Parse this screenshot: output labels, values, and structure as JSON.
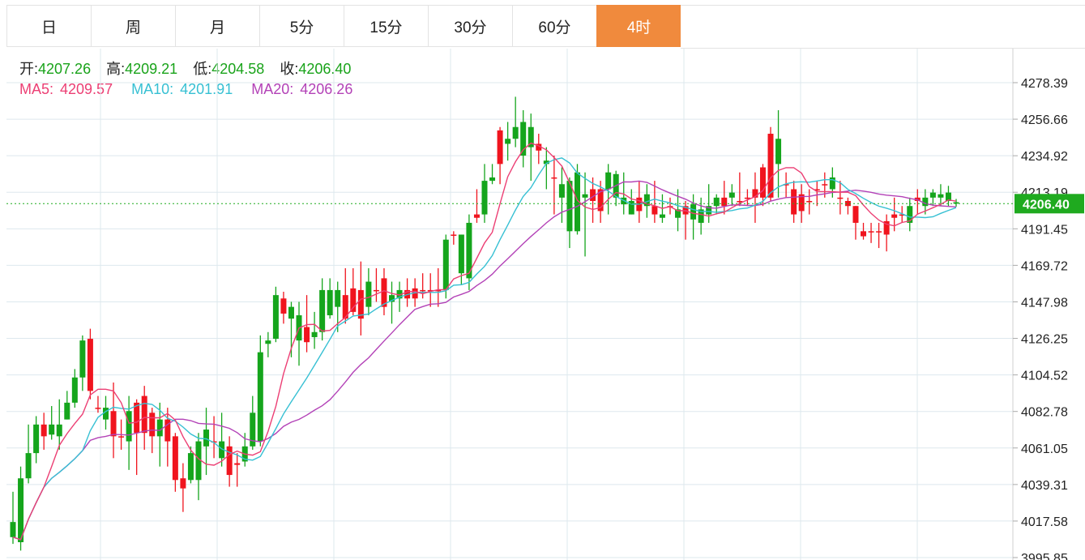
{
  "tabs": [
    {
      "label": "日",
      "active": false
    },
    {
      "label": "周",
      "active": false
    },
    {
      "label": "月",
      "active": false
    },
    {
      "label": "5分",
      "active": false
    },
    {
      "label": "15分",
      "active": false
    },
    {
      "label": "30分",
      "active": false
    },
    {
      "label": "60分",
      "active": false
    },
    {
      "label": "4时",
      "active": true
    }
  ],
  "ohlc": {
    "open_label": "开:",
    "open": "4207.26",
    "high_label": "高:",
    "high": "4209.21",
    "low_label": "低:",
    "low": "4204.58",
    "close_label": "收:",
    "close": "4206.40"
  },
  "ma": {
    "ma5_label": "MA5:",
    "ma5": "4209.57",
    "ma10_label": "MA10:",
    "ma10": "4201.91",
    "ma20_label": "MA20:",
    "ma20": "4206.26"
  },
  "colors": {
    "up": "#f0141e",
    "down": "#15a51c",
    "ma5": "#ec3f74",
    "ma10": "#37c0d3",
    "ma20": "#b342b7",
    "active_tab": "#f08a3d",
    "price_line": "#1faa1f",
    "grid": "#dde8ee"
  },
  "chart_data": {
    "type": "candlestick",
    "y_ticks": [
      "4278.39",
      "4256.66",
      "4234.92",
      "4213.19",
      "4191.45",
      "4169.72",
      "4147.98",
      "4126.25",
      "4104.52",
      "4082.78",
      "4061.05",
      "4039.31",
      "4017.58",
      "3995.85"
    ],
    "ylim": [
      3995.85,
      4289
    ],
    "last_price": "4206.40",
    "grid": true,
    "candles": [
      [
        4017,
        4008,
        4035,
        4004
      ],
      [
        4043,
        4005,
        4050,
        4000
      ],
      [
        4058,
        4043,
        4075,
        4040
      ],
      [
        4075,
        4058,
        4080,
        4052
      ],
      [
        4068,
        4075,
        4082,
        4060
      ],
      [
        4075,
        4069,
        4086,
        4066
      ],
      [
        4075,
        4068,
        4090,
        4060
      ],
      [
        4088,
        4078,
        4095,
        4078
      ],
      [
        4103,
        4088,
        4108,
        4085
      ],
      [
        4125,
        4103,
        4128,
        4095
      ],
      [
        4095,
        4126,
        4132,
        4090
      ],
      [
        4085,
        4085,
        4092,
        4082
      ],
      [
        4085,
        4078,
        4092,
        4072
      ],
      [
        4068,
        4083,
        4100,
        4055
      ],
      [
        4068,
        4068,
        4078,
        4060
      ],
      [
        4083,
        4065,
        4092,
        4048
      ],
      [
        4070,
        4088,
        4090,
        4045
      ],
      [
        4070,
        4092,
        4098,
        4060
      ],
      [
        4068,
        4082,
        4085,
        4058
      ],
      [
        4078,
        4068,
        4088,
        4050
      ],
      [
        4065,
        4078,
        4085,
        4050
      ],
      [
        4042,
        4068,
        4070,
        4035
      ],
      [
        4037,
        4043,
        4052,
        4023
      ],
      [
        4058,
        4042,
        4062,
        4040
      ],
      [
        4065,
        4042,
        4070,
        4030
      ],
      [
        4072,
        4062,
        4085,
        4045
      ],
      [
        4065,
        4065,
        4080,
        4055
      ],
      [
        4065,
        4055,
        4082,
        4050
      ],
      [
        4045,
        4062,
        4068,
        4038
      ],
      [
        4051,
        4052,
        4058,
        4038
      ],
      [
        4062,
        4053,
        4070,
        4050
      ],
      [
        4082,
        4062,
        4092,
        4060
      ],
      [
        4118,
        4065,
        4128,
        4062
      ],
      [
        4125,
        4123,
        4130,
        4115
      ],
      [
        4152,
        4126,
        4157,
        4124
      ],
      [
        4141,
        4150,
        4154,
        4135
      ],
      [
        4145,
        4138,
        4148,
        4115
      ],
      [
        4140,
        4125,
        4148,
        4110
      ],
      [
        4124,
        4133,
        4152,
        4118
      ],
      [
        4130,
        4127,
        4142,
        4120
      ],
      [
        4155,
        4130,
        4162,
        4125
      ],
      [
        4155,
        4140,
        4162,
        4138
      ],
      [
        4155,
        4145,
        4160,
        4130
      ],
      [
        4138,
        4152,
        4168,
        4135
      ],
      [
        4142,
        4156,
        4168,
        4140
      ],
      [
        4138,
        4155,
        4172,
        4128
      ],
      [
        4160,
        4145,
        4168,
        4140
      ],
      [
        4155,
        4155,
        4168,
        4148
      ],
      [
        4145,
        4162,
        4168,
        4140
      ],
      [
        4152,
        4148,
        4160,
        4135
      ],
      [
        4155,
        4150,
        4160,
        4142
      ],
      [
        4150,
        4155,
        4162,
        4145
      ],
      [
        4150,
        4156,
        4162,
        4145
      ],
      [
        4155,
        4155,
        4165,
        4150
      ],
      [
        4155,
        4155,
        4165,
        4145
      ],
      [
        4155,
        4155,
        4168,
        4145
      ],
      [
        4185,
        4155,
        4188,
        4150
      ],
      [
        4188,
        4188,
        4190,
        4182
      ],
      [
        4188,
        4165,
        4188,
        4158
      ],
      [
        4195,
        4162,
        4200,
        4155
      ],
      [
        4198,
        4200,
        4215,
        4195
      ],
      [
        4220,
        4200,
        4230,
        4195
      ],
      [
        4222,
        4220,
        4230,
        4218
      ],
      [
        4230,
        4250,
        4252,
        4218
      ],
      [
        4245,
        4242,
        4255,
        4232
      ],
      [
        4252,
        4245,
        4270,
        4240
      ],
      [
        4255,
        4235,
        4262,
        4228
      ],
      [
        4252,
        4240,
        4260,
        4220
      ],
      [
        4238,
        4242,
        4248,
        4230
      ],
      [
        4232,
        4230,
        4240,
        4215
      ],
      [
        4222,
        4222,
        4235,
        4200
      ],
      [
        4218,
        4210,
        4228,
        4195
      ],
      [
        4220,
        4190,
        4222,
        4180
      ],
      [
        4225,
        4190,
        4230,
        4188
      ],
      [
        4212,
        4210,
        4225,
        4175
      ],
      [
        4208,
        4215,
        4222,
        4195
      ],
      [
        4202,
        4215,
        4220,
        4195
      ],
      [
        4225,
        4215,
        4230,
        4200
      ],
      [
        4224,
        4210,
        4226,
        4205
      ],
      [
        4210,
        4206,
        4225,
        4200
      ],
      [
        4208,
        4200,
        4215,
        4200
      ],
      [
        4202,
        4210,
        4220,
        4195
      ],
      [
        4212,
        4205,
        4218,
        4198
      ],
      [
        4200,
        4205,
        4220,
        4195
      ],
      [
        4200,
        4198,
        4212,
        4195
      ],
      [
        4205,
        4205,
        4210,
        4200
      ],
      [
        4203,
        4198,
        4215,
        4190
      ],
      [
        4200,
        4205,
        4208,
        4185
      ],
      [
        4206,
        4197,
        4212,
        4185
      ],
      [
        4203,
        4195,
        4210,
        4188
      ],
      [
        4205,
        4200,
        4218,
        4195
      ],
      [
        4210,
        4205,
        4212,
        4200
      ],
      [
        4205,
        4210,
        4220,
        4200
      ],
      [
        4213,
        4210,
        4218,
        4205
      ],
      [
        4208,
        4208,
        4225,
        4205
      ],
      [
        4210,
        4210,
        4215,
        4205
      ],
      [
        4210,
        4215,
        4225,
        4195
      ],
      [
        4210,
        4228,
        4230,
        4205
      ],
      [
        4210,
        4248,
        4252,
        4208
      ],
      [
        4245,
        4230,
        4262,
        4210
      ],
      [
        4218,
        4218,
        4225,
        4210
      ],
      [
        4200,
        4215,
        4220,
        4195
      ],
      [
        4202,
        4212,
        4218,
        4195
      ],
      [
        4208,
        4208,
        4215,
        4200
      ],
      [
        4215,
        4215,
        4220,
        4205
      ],
      [
        4218,
        4218,
        4225,
        4210
      ],
      [
        4222,
        4215,
        4228,
        4210
      ],
      [
        4210,
        4210,
        4220,
        4200
      ],
      [
        4205,
        4208,
        4210,
        4200
      ],
      [
        4195,
        4205,
        4205,
        4185
      ],
      [
        4187,
        4190,
        4195,
        4185
      ],
      [
        4190,
        4190,
        4195,
        4183
      ],
      [
        4190,
        4190,
        4195,
        4180
      ],
      [
        4188,
        4196,
        4200,
        4178
      ],
      [
        4198,
        4200,
        4210,
        4190
      ],
      [
        4200,
        4200,
        4205,
        4195
      ],
      [
        4205,
        4195,
        4210,
        4190
      ],
      [
        4208,
        4210,
        4215,
        4200
      ],
      [
        4210,
        4205,
        4215,
        4200
      ],
      [
        4213,
        4210,
        4215,
        4205
      ],
      [
        4212,
        4210,
        4218,
        4205
      ],
      [
        4213,
        4208,
        4217,
        4205
      ],
      [
        4207.26,
        4206.4,
        4209.21,
        4204.58
      ]
    ]
  }
}
